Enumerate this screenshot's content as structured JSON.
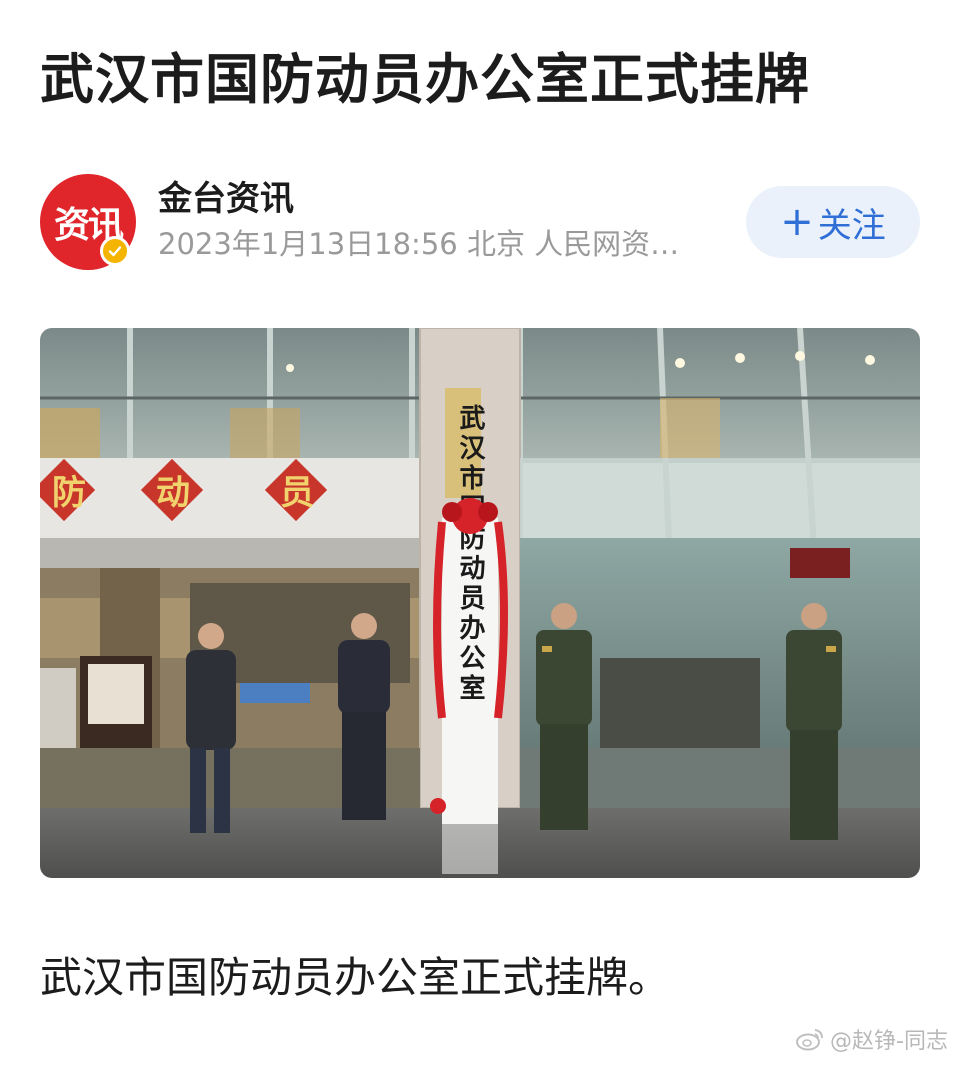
{
  "article": {
    "headline": "武汉市国防动员办公室正式挂牌",
    "caption": "武汉市国防动员办公室正式挂牌。"
  },
  "author": {
    "avatar_text": "资讯",
    "name": "金台资讯",
    "meta": "2023年1月13日18:56  北京  人民网资…",
    "follow_label": "关注",
    "follow_icon": "plus-icon"
  },
  "photo": {
    "sign_text": "武汉市国防动员办公室",
    "wall_chars": [
      "防",
      "动",
      "员"
    ]
  },
  "watermark": {
    "text": "@赵铮-同志",
    "icon": "weibo-icon"
  },
  "colors": {
    "accent_red": "#e0252b",
    "follow_blue": "#2f6fd6",
    "follow_bg": "#eaf1fb",
    "meta_gray": "#9a9a9a",
    "badge_gold": "#f5b400"
  }
}
